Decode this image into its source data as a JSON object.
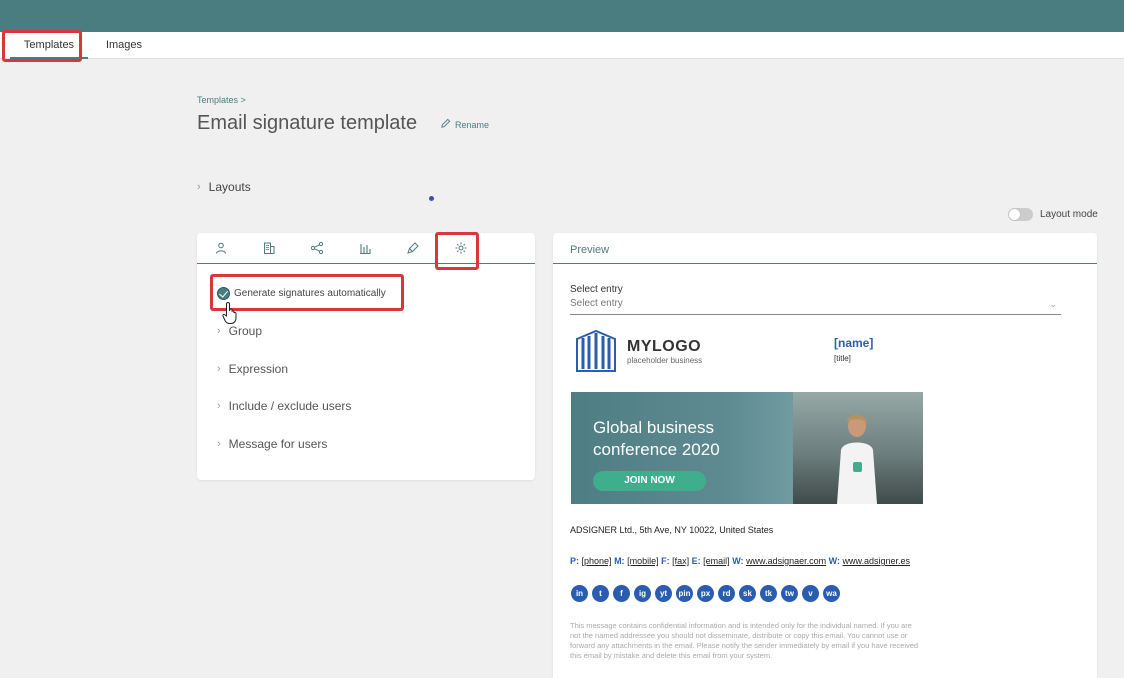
{
  "tabs": [
    {
      "label": "Templates",
      "active": true
    },
    {
      "label": "Images",
      "active": false
    }
  ],
  "breadcrumb": "Templates >",
  "page_title": "Email signature template",
  "rename_label": "Rename",
  "layouts_label": "Layouts",
  "layout_mode": {
    "label": "Layout mode",
    "on": false
  },
  "settings_icons": [
    "person-icon",
    "building-icon",
    "share-icon",
    "chart-icon",
    "brush-icon",
    "gear-icon"
  ],
  "generate_label": "Generate signatures automatically",
  "generate_checked": true,
  "accordion": [
    "Group",
    "Expression",
    "Include / exclude users",
    "Message for users"
  ],
  "preview": {
    "tab_label": "Preview",
    "select_label": "Select entry",
    "select_placeholder": "Select entry",
    "logo_main": "MYLOGO",
    "logo_sub": "placeholder business",
    "name": "[name]",
    "title": "[title]",
    "banner_heading_1": "Global business",
    "banner_heading_2": "conference 2020",
    "banner_button": "JOIN NOW",
    "address": "ADSIGNER Ltd., 5th Ave, NY 10022, United States",
    "contacts": {
      "p_label": "P:",
      "p_value": "[phone]",
      "m_label": "M:",
      "m_value": "[mobile]",
      "f_label": "F:",
      "f_value": "[fax]",
      "e_label": "E:",
      "e_value": "[email]",
      "w1_label": "W:",
      "w1_value": "www.adsignaer.com",
      "w2_label": "W:",
      "w2_value": "www.adsigner.es"
    },
    "social": [
      "in",
      "t",
      "f",
      "ig",
      "yt",
      "pin",
      "px",
      "rd",
      "sk",
      "tk",
      "tw",
      "v",
      "wa"
    ],
    "disclaimer": "This message contains confidential information and is intended only for the individual named. If you are not the named addressee you should not disseminate, distribute or copy this email. You cannot use or forward any attachments in the email. Please notify the sender immediately by email if you have received this email by mistake and delete this email from your system."
  },
  "colors": {
    "accent": "#4a7d80",
    "highlight": "#d9373b",
    "brand_blue": "#2a5db0"
  }
}
